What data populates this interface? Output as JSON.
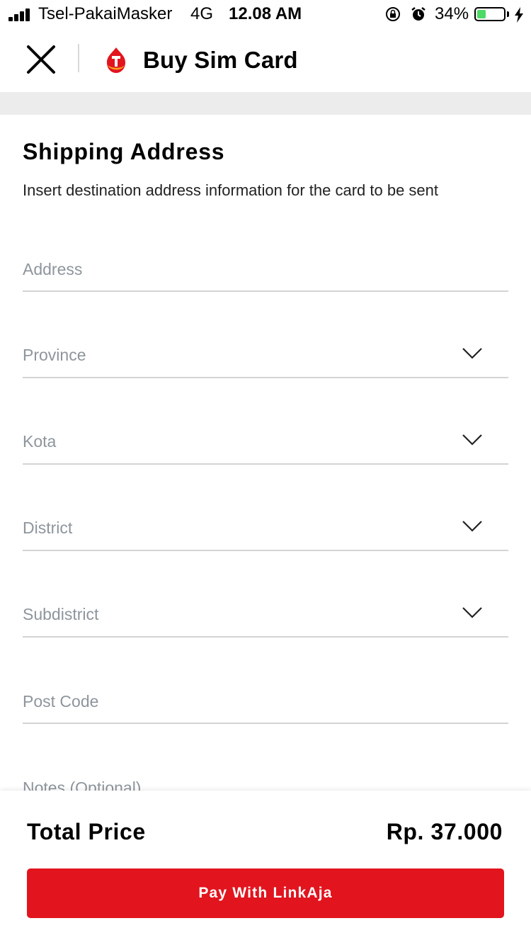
{
  "status_bar": {
    "carrier": "Tsel-PakaiMasker",
    "network": "4G",
    "time": "12.08 AM",
    "battery_percent": "34%",
    "battery_level": 0.34,
    "icons": [
      "signal-icon",
      "rotation-lock-icon",
      "alarm-icon",
      "battery-icon",
      "charging-bolt-icon"
    ]
  },
  "header": {
    "title": "Buy Sim Card",
    "close_icon": "close-icon",
    "logo_icon": "telkomsel-logo-icon",
    "logo_color": "#e2141e"
  },
  "form": {
    "title": "Shipping Address",
    "subtitle": "Insert destination address information for the card to be sent",
    "address_placeholder": "Address",
    "province_label": "Province",
    "kota_label": "Kota",
    "district_label": "District",
    "subdistrict_label": "Subdistrict",
    "postcode_placeholder": "Post Code",
    "notes_placeholder": "Notes (Optional)",
    "dropdown_icon": "chevron-down-icon"
  },
  "footer": {
    "total_label": "Total Price",
    "total_value": "Rp. 37.000",
    "pay_button": "Pay With LinkAja",
    "button_color": "#e2141e"
  }
}
